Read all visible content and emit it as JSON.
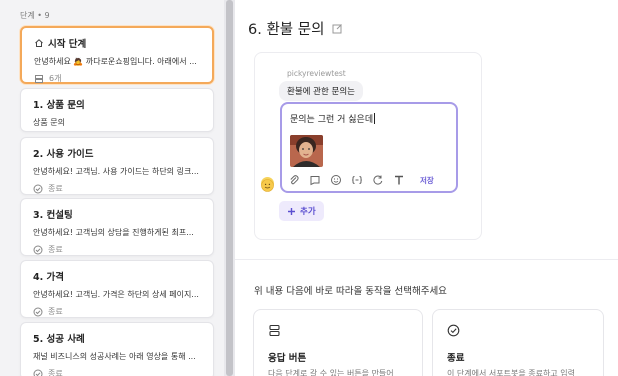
{
  "sidebar": {
    "count_label": "단계 • 9",
    "items": [
      {
        "title": "시작 단계",
        "desc": "안녕하세요 🙇 까다로운쇼핑입니다. 아래에서 ...",
        "meta": "6개"
      },
      {
        "title": "1. 상품 문의",
        "desc": "상품 문의"
      },
      {
        "title": "2. 사용 가이드",
        "desc": "안녕하세요! 고객님. 사용 가이드는 하단의 링크...",
        "meta": "종료"
      },
      {
        "title": "3. 컨설팅",
        "desc": "안녕하세요! 고객님의 상담을 진행하게된 최프...",
        "meta": "종료"
      },
      {
        "title": "4. 가격",
        "desc": "안녕하세요! 고객님. 가격은 하단의 상세 페이지...",
        "meta": "종료"
      },
      {
        "title": "5. 성공 사례",
        "desc": "재널 비즈니스의 성공사례는 아래 영상을 통해 ...",
        "meta": "종료"
      }
    ]
  },
  "main": {
    "title": "6.  환불 문의",
    "sender": "pickyreviewtest",
    "bubble": "환불에 관한 문의는",
    "editor_text": "문의는 그런 거 싫은데",
    "save_label": "저장",
    "add_label": "추가",
    "prompt": "위 내용 다음에 바로 따라올 동작을 선택해주세요",
    "options": [
      {
        "title": "응답 버튼",
        "desc": "다음 단계로 갈 수 있는 버튼을 만들어",
        "icon": "button-icon"
      },
      {
        "title": "종료",
        "desc": "이 단계에서 서포트봇을 종료하고 입력",
        "icon": "check-circle-icon"
      }
    ]
  },
  "colors": {
    "active_border": "#f4a95a",
    "accent": "#6d5fd6",
    "editor_border": "#a79be8"
  }
}
